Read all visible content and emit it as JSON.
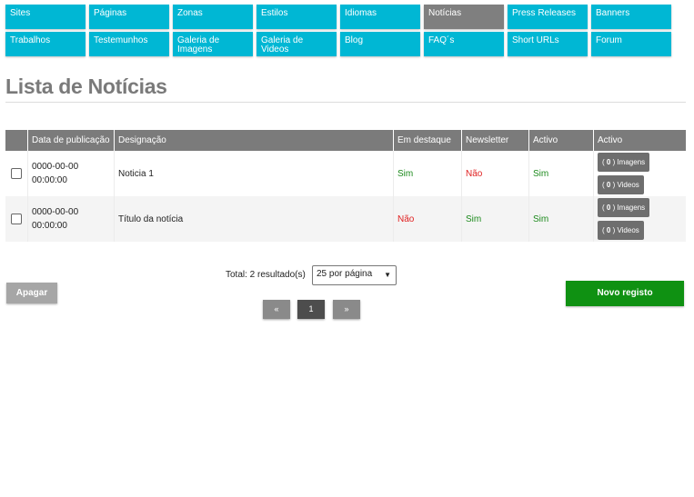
{
  "nav": {
    "row1": [
      "Sites",
      "Páginas",
      "Zonas",
      "Estilos",
      "Idiomas",
      "Notícias",
      "Press Releases",
      "Banners"
    ],
    "row2": [
      "Trabalhos",
      "Testemunhos",
      "Galeria de Imagens",
      "Galeria de Videos",
      "Blog",
      "FAQ´s",
      "Short URLs",
      "Forum"
    ],
    "active": "Notícias"
  },
  "page": {
    "title": "Lista de Notícias"
  },
  "table": {
    "headers": [
      "",
      "Data de publicação",
      "Designação",
      "Em destaque",
      "Newsletter",
      "Activo",
      "Activo"
    ],
    "rows": [
      {
        "date": "0000-00-00",
        "time": "00:00:00",
        "designation": "Noticia 1",
        "featured": "Sim",
        "newsletter": "Não",
        "active": "Sim",
        "images_btn": "Imagens",
        "images_count": "0",
        "videos_btn": "Videos",
        "videos_count": "0"
      },
      {
        "date": "0000-00-00",
        "time": "00:00:00",
        "designation": "Título da notícia",
        "featured": "Não",
        "newsletter": "Sim",
        "active": "Sim",
        "images_btn": "Imagens",
        "images_count": "0",
        "videos_btn": "Videos",
        "videos_count": "0"
      }
    ]
  },
  "pagination": {
    "total_label": "Total: 2 resultado(s)",
    "per_page": "25 por página",
    "prev": "«",
    "current": "1",
    "next": "»"
  },
  "actions": {
    "delete": "Apagar",
    "new": "Novo registo"
  },
  "colors": {
    "nav": "#00b7d4",
    "nav_active": "#7f7f7f",
    "header": "#7b7b7b",
    "yes": "#1c8a1c",
    "no": "#e02020",
    "new_button": "#0f9112"
  }
}
